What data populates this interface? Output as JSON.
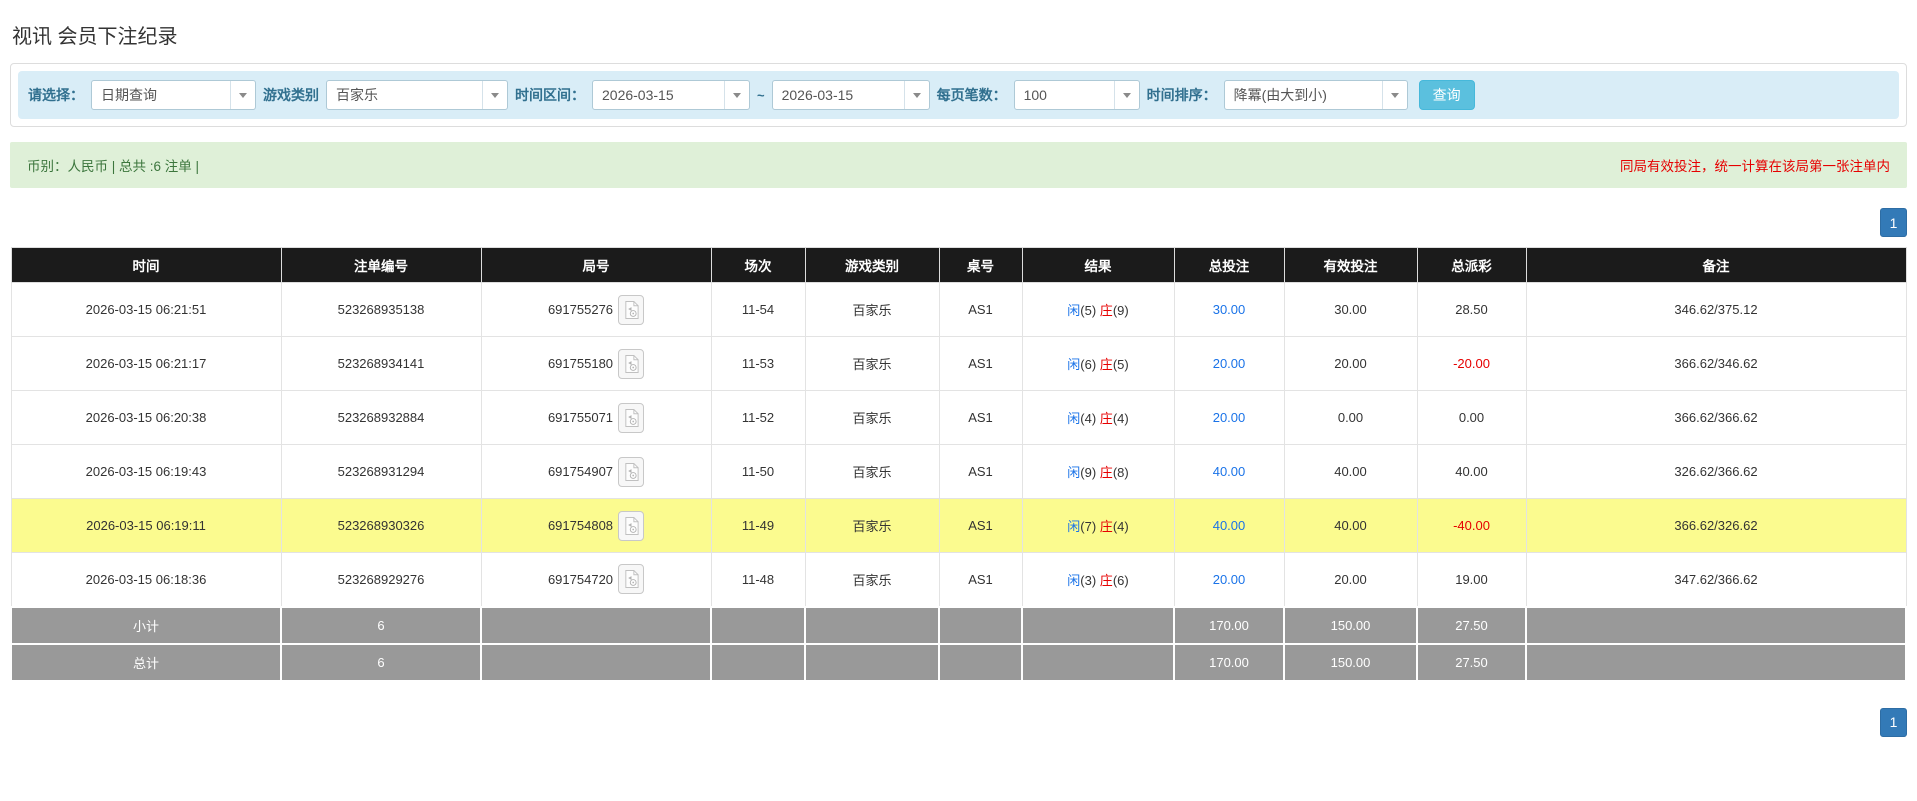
{
  "page_title": "视讯 会员下注纪录",
  "filter_bar": {
    "query_type_label": "请选择：",
    "query_type_value": "日期查询",
    "game_category_label": "游戏类别",
    "game_category_value": "百家乐",
    "time_range_label": "时间区间：",
    "date_from": "2026-03-15",
    "range_separator": "~",
    "date_to": "2026-03-15",
    "page_size_label": "每页笔数：",
    "page_size_value": "100",
    "time_sort_label": "时间排序：",
    "time_sort_value": "降冪(由大到小)",
    "search_button_label": "查询"
  },
  "summary_bar": {
    "left_text": "币别：人民币 | 总共 :6 注单 |",
    "right_notice": "同局有效投注，统一计算在该局第一张注单内"
  },
  "pagination": {
    "current_page": "1"
  },
  "table": {
    "headers": [
      "时间",
      "注单编号",
      "局号",
      "场次",
      "游戏类别",
      "桌号",
      "结果",
      "总投注",
      "有效投注",
      "总派彩",
      "备注"
    ],
    "rows": [
      {
        "time": "2026-03-15 06:21:51",
        "bet_id": "523268935138",
        "round": "691755276",
        "session": "11-54",
        "game": "百家乐",
        "table_no": "AS1",
        "result": {
          "player_label": "闲",
          "player_score": "(5)",
          "banker_label": "庄",
          "banker_score": "(9)"
        },
        "total_bet": "30.00",
        "valid_bet": "30.00",
        "payout": "28.50",
        "remark": "346.62/375.12",
        "highlight": false
      },
      {
        "time": "2026-03-15 06:21:17",
        "bet_id": "523268934141",
        "round": "691755180",
        "session": "11-53",
        "game": "百家乐",
        "table_no": "AS1",
        "result": {
          "player_label": "闲",
          "player_score": "(6)",
          "banker_label": "庄",
          "banker_score": "(5)"
        },
        "total_bet": "20.00",
        "valid_bet": "20.00",
        "payout": "-20.00",
        "remark": "366.62/346.62",
        "highlight": false
      },
      {
        "time": "2026-03-15 06:20:38",
        "bet_id": "523268932884",
        "round": "691755071",
        "session": "11-52",
        "game": "百家乐",
        "table_no": "AS1",
        "result": {
          "player_label": "闲",
          "player_score": "(4)",
          "banker_label": "庄",
          "banker_score": "(4)"
        },
        "total_bet": "20.00",
        "valid_bet": "0.00",
        "payout": "0.00",
        "remark": "366.62/366.62",
        "highlight": false
      },
      {
        "time": "2026-03-15 06:19:43",
        "bet_id": "523268931294",
        "round": "691754907",
        "session": "11-50",
        "game": "百家乐",
        "table_no": "AS1",
        "result": {
          "player_label": "闲",
          "player_score": "(9)",
          "banker_label": "庄",
          "banker_score": "(8)"
        },
        "total_bet": "40.00",
        "valid_bet": "40.00",
        "payout": "40.00",
        "remark": "326.62/366.62",
        "highlight": false
      },
      {
        "time": "2026-03-15 06:19:11",
        "bet_id": "523268930326",
        "round": "691754808",
        "session": "11-49",
        "game": "百家乐",
        "table_no": "AS1",
        "result": {
          "player_label": "闲",
          "player_score": "(7)",
          "banker_label": "庄",
          "banker_score": "(4)"
        },
        "total_bet": "40.00",
        "valid_bet": "40.00",
        "payout": "-40.00",
        "remark": "366.62/326.62",
        "highlight": true
      },
      {
        "time": "2026-03-15 06:18:36",
        "bet_id": "523268929276",
        "round": "691754720",
        "session": "11-48",
        "game": "百家乐",
        "table_no": "AS1",
        "result": {
          "player_label": "闲",
          "player_score": "(3)",
          "banker_label": "庄",
          "banker_score": "(6)"
        },
        "total_bet": "20.00",
        "valid_bet": "20.00",
        "payout": "19.00",
        "remark": "347.62/366.62",
        "highlight": false
      }
    ],
    "footer_rows": [
      {
        "label": "小计",
        "count": "6",
        "total_bet": "170.00",
        "valid_bet": "150.00",
        "payout": "27.50"
      },
      {
        "label": "总计",
        "count": "6",
        "total_bet": "170.00",
        "valid_bet": "150.00",
        "payout": "27.50"
      }
    ]
  },
  "icons": {
    "video_replay": "video-file-icon",
    "dropdown": "chevron-down-icon"
  },
  "colors": {
    "filter_bg": "#d9edf7",
    "filter_label": "#31708f",
    "search_btn": "#5bc0de",
    "summary_bg": "#dff0d8",
    "summary_text": "#3c763d",
    "notice_red": "#e60000",
    "header_bg": "#1b1b1b",
    "highlight_yellow": "#fbfb8f",
    "link_blue": "#1a73e8",
    "loss_red": "#e60000",
    "footer_bg": "#999999",
    "pager_blue": "#337ab7"
  }
}
